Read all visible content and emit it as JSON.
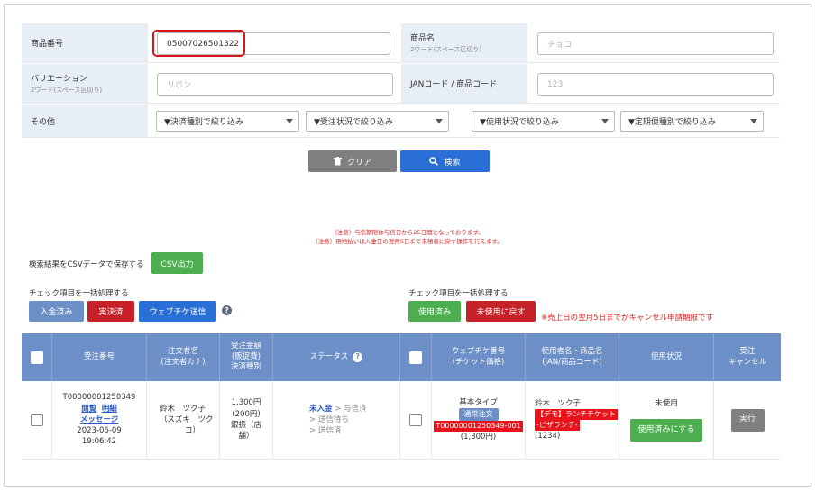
{
  "search": {
    "product_number": {
      "label": "商品番号",
      "value": "05007026501322"
    },
    "product_name": {
      "label": "商品名",
      "sub": "2ワード(スペース区切り)",
      "placeholder": "チョコ"
    },
    "variation": {
      "label": "バリエーション",
      "sub": "2ワード(スペース区切り)",
      "placeholder": "リボン"
    },
    "jan": {
      "label": "JANコード / 商品コード",
      "placeholder": "123"
    },
    "other": {
      "label": "その他",
      "filters": [
        "▼決済種別で絞り込み",
        "▼受注状況で絞り込み",
        "▼使用状況で絞り込み",
        "▼定期便種別で絞り込み"
      ]
    }
  },
  "actions": {
    "clear_label": "クリア",
    "search_label": "検索"
  },
  "notices": [
    "（注意）与信期限は与信日から25日間となっております。",
    "（注意）現地払いは入金日の翌月5日まで未領収に戻す操作を行えます。"
  ],
  "csv": {
    "label": "検索結果をCSVデータで保存する",
    "button": "CSV出力"
  },
  "bulk_left": {
    "label": "チェック項目を一括処理する",
    "buttons": [
      "入金済み",
      "実決済",
      "ウェブチケ送信"
    ]
  },
  "bulk_right": {
    "label": "チェック項目を一括処理する",
    "buttons": [
      "使用済み",
      "未使用に戻す"
    ],
    "warning": "※売上日の翌月5日までがキャンセル申請期限です"
  },
  "table": {
    "headers": {
      "order_no": "受注番号",
      "customer": [
        "注文者名",
        "(注文者カナ)"
      ],
      "amount": [
        "受注金額",
        "(販促費)",
        "決済種別"
      ],
      "status": "ステータス",
      "ticket": [
        "ウェブチケ番号",
        "(チケット価格)"
      ],
      "user_product": [
        "使用者名・商品名",
        "(JAN/商品コード)"
      ],
      "usage": "使用状況",
      "cancel": [
        "受注",
        "キャンセル"
      ]
    },
    "rows": [
      {
        "order_no": "T00000001250349",
        "view_link": "閲覧",
        "detail_link": "明細",
        "message_link": "メッセージ",
        "date": "2023-06-09",
        "time": "19:06:42",
        "customer_name": "鈴木　ツク子",
        "customer_kana": [
          "（スズキ　ツク",
          "コ）"
        ],
        "amount": "1,300円",
        "promo": "(200円)",
        "payment": [
          "銀振（店",
          "舗）"
        ],
        "status_current": "未入金",
        "status_next1": "> 与信済",
        "status_next2": "> 送信待ち",
        "status_next3": "> 送信済",
        "ticket_type": "基本タイプ",
        "ticket_badge": "通常注文",
        "ticket_no": "T00000001250349-001",
        "ticket_price": "(1,300円)",
        "user_name": "鈴木　ツク子",
        "product_line1": "【デモ】ランチチケット",
        "product_line2": "-ピザランチ-",
        "product_code": "(1234)",
        "usage_status": "未使用",
        "usage_button": "使用済みにする",
        "cancel_button": "実行"
      }
    ]
  },
  "colors": {
    "accent": "#2a6fd6",
    "header": "#6d8fc7",
    "danger": "#c62127",
    "success": "#4cae4f",
    "highlight": "#d8141b"
  }
}
